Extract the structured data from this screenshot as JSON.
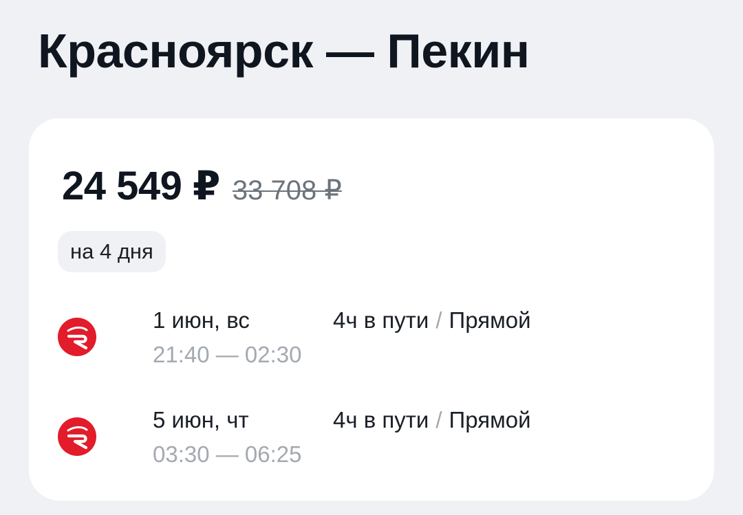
{
  "route": {
    "title": "Красноярск — Пекин"
  },
  "offer": {
    "price": "24 549 ₽",
    "old_price": "33 708 ₽",
    "duration_badge": "на 4 дня"
  },
  "flights": [
    {
      "date": "1 июн, вс",
      "times": "21:40 — 02:30",
      "travel_time": "4ч в пути",
      "separator": "/",
      "stops": "Прямой",
      "airline_icon": "red-wings-logo-icon"
    },
    {
      "date": "5 июн, чт",
      "times": "03:30 — 06:25",
      "travel_time": "4ч в пути",
      "separator": "/",
      "stops": "Прямой",
      "airline_icon": "red-wings-logo-icon"
    }
  ],
  "colors": {
    "background": "#eff1f4",
    "card": "#ffffff",
    "text_primary": "#0f1620",
    "text_muted": "#a3a9b0",
    "old_price": "#6c737b",
    "airline_brand": "#e21c2a"
  }
}
